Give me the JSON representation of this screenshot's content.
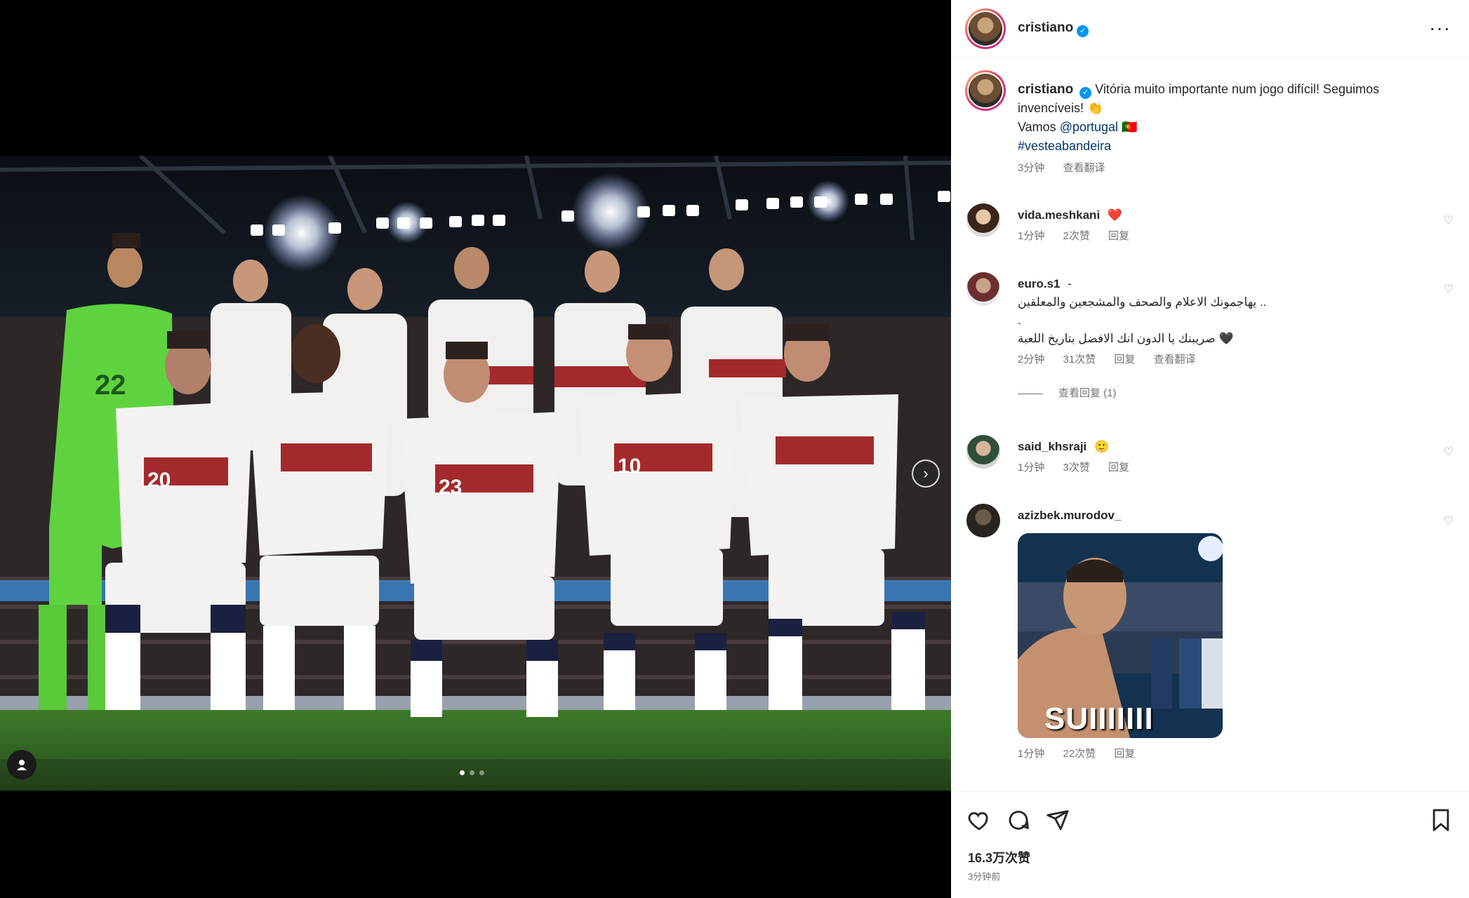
{
  "post": {
    "username": "cristiano",
    "more_icon": "more-options-icon"
  },
  "caption": {
    "username": "cristiano",
    "text": "Vitória muito importante num jogo difícil! Seguimos invencíveis! 👏",
    "line2_prefix": "Vamos",
    "mention": "@portugal",
    "flag": "🇵🇹",
    "hashtag": "#vesteabandeira",
    "time": "3分钟",
    "translate": "查看翻译"
  },
  "comments": [
    {
      "username": "vida.meshkani",
      "text": "❤️",
      "time": "1分钟",
      "likes": "2次赞",
      "reply": "回复"
    },
    {
      "username": "euro.s1",
      "text_line1": "يهاجمونك الاعلام والصحف والمشجعين والمعلقين ..",
      "text_line2": ".",
      "text_line3": "صريبنك يا الدون انك الافضل بتاريخ اللعبة 🖤",
      "time": "2分钟",
      "likes": "31次赞",
      "reply": "回复",
      "translate": "查看翻译",
      "view_replies": "查看回复 (1)"
    },
    {
      "username": "said_khsraji",
      "text": "🙂",
      "time": "1分钟",
      "likes": "3次赞",
      "reply": "回复"
    },
    {
      "username": "azizbek.murodov_",
      "gif_text": "SUIIIIIII",
      "time": "1分钟",
      "likes": "22次赞",
      "reply": "回复"
    }
  ],
  "actions": {
    "like_icon": "heart-icon",
    "comment_icon": "comment-icon",
    "share_icon": "share-icon",
    "save_icon": "bookmark-icon"
  },
  "likes_count": "16.3万次赞",
  "posted_time": "3分钟前",
  "carousel": {
    "count": 3,
    "active": 0
  }
}
